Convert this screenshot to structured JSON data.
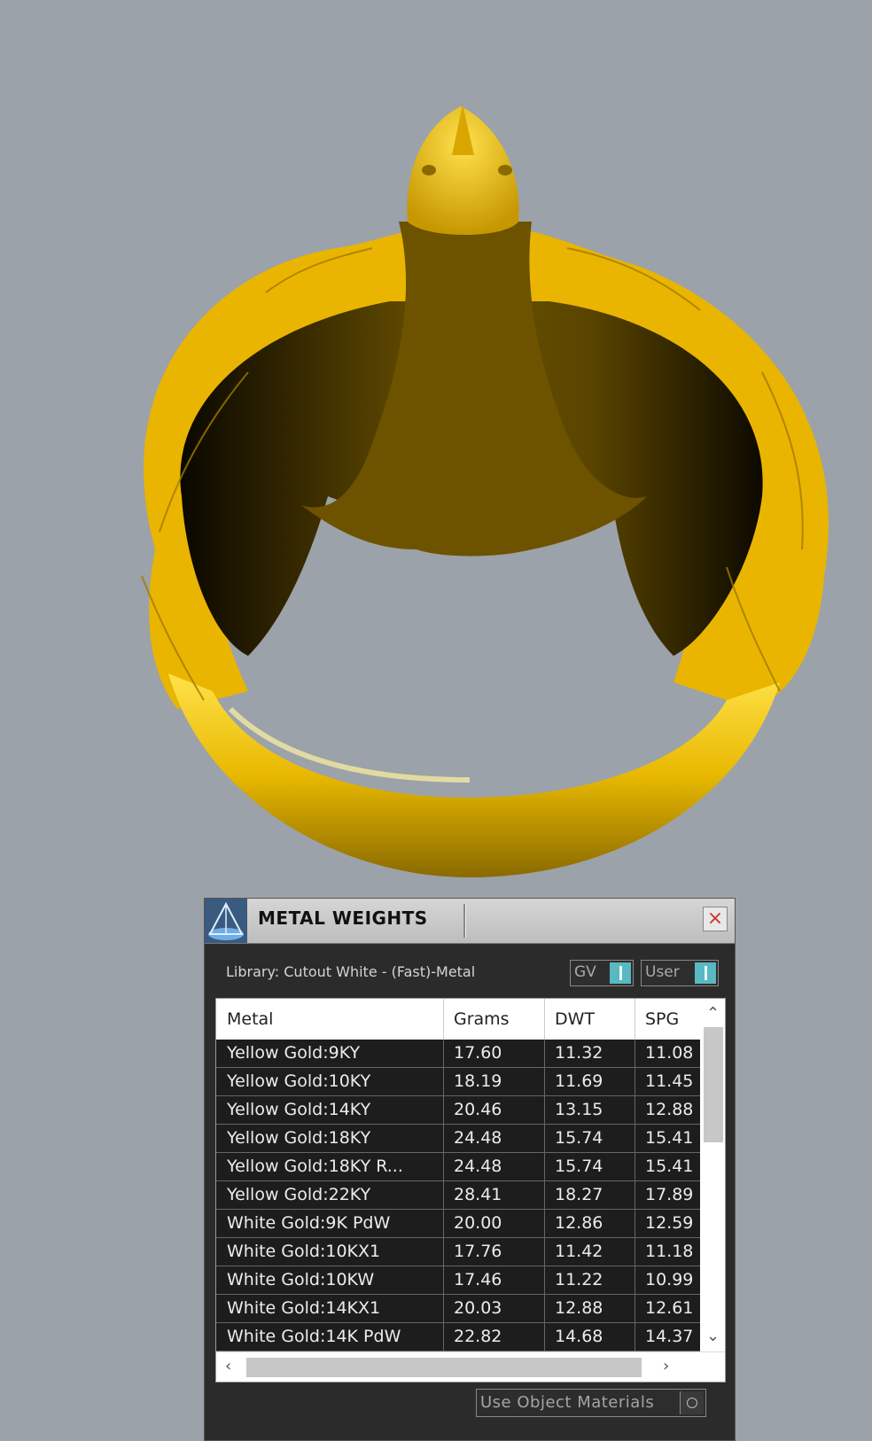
{
  "panel": {
    "title": "METAL WEIGHTS",
    "close_icon": "close-icon",
    "library_label": "Library: Cutout White - (Fast)-Metal",
    "toggle_gv": "GV",
    "toggle_user": "User",
    "use_object_materials": "Use Object Materials"
  },
  "table": {
    "headers": [
      "Metal",
      "Grams",
      "DWT",
      "SPG"
    ],
    "rows": [
      [
        "Yellow Gold:9KY",
        "17.60",
        "11.32",
        "11.08"
      ],
      [
        "Yellow Gold:10KY",
        "18.19",
        "11.69",
        "11.45"
      ],
      [
        "Yellow Gold:14KY",
        "20.46",
        "13.15",
        "12.88"
      ],
      [
        "Yellow Gold:18KY",
        "24.48",
        "15.74",
        "15.41"
      ],
      [
        "Yellow Gold:18KY R...",
        "24.48",
        "15.74",
        "15.41"
      ],
      [
        "Yellow Gold:22KY",
        "28.41",
        "18.27",
        "17.89"
      ],
      [
        "White Gold:9K PdW",
        "20.00",
        "12.86",
        "12.59"
      ],
      [
        "White Gold:10KX1",
        "17.76",
        "11.42",
        "11.18"
      ],
      [
        "White Gold:10KW",
        "17.46",
        "11.22",
        "10.99"
      ],
      [
        "White Gold:14KX1",
        "20.03",
        "12.88",
        "12.61"
      ],
      [
        "White Gold:14K PdW",
        "22.82",
        "14.68",
        "14.37"
      ]
    ]
  },
  "colors": {
    "viewport_bg": "#9ba2a9",
    "gold": "#f2c200",
    "panel_bg": "#2b2b2b",
    "toggle_accent": "#59b8c2"
  },
  "icons": {
    "app": "pyramid-app-icon",
    "scroll_up": "chevron-up-icon",
    "scroll_down": "chevron-down-icon",
    "scroll_left": "chevron-left-icon",
    "scroll_right": "chevron-right-icon"
  }
}
